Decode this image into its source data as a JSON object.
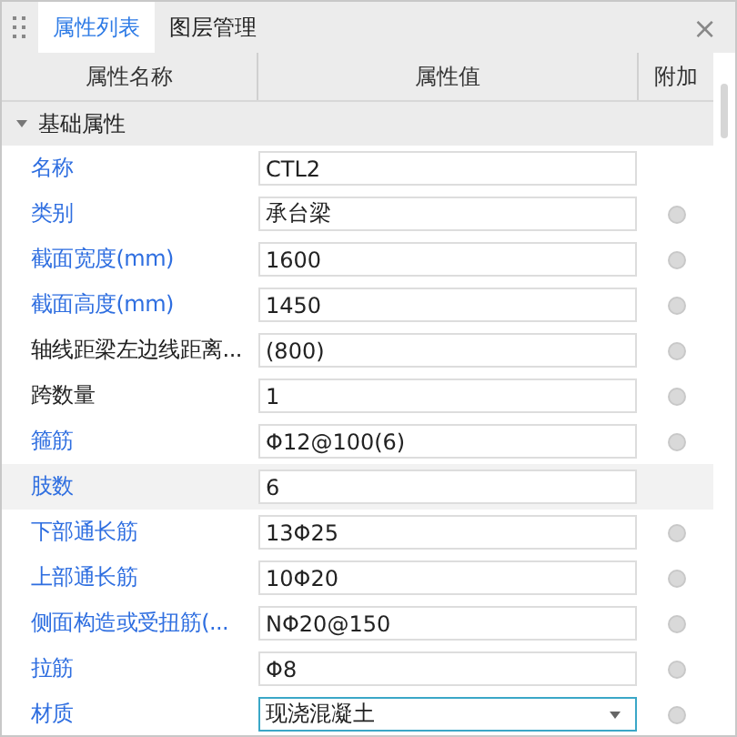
{
  "tabs": [
    {
      "label": "属性列表",
      "selected": true
    },
    {
      "label": "图层管理",
      "selected": false
    }
  ],
  "close": "×",
  "columns": [
    "属性名称",
    "属性值",
    "附加"
  ],
  "group": {
    "label": "基础属性",
    "expanded": true
  },
  "rows": [
    {
      "name": "名称",
      "public": true,
      "value": "CTL2",
      "kind": "text",
      "attach": false,
      "selected": false
    },
    {
      "name": "类别",
      "public": true,
      "value": "承台梁",
      "kind": "text",
      "attach": true,
      "selected": false
    },
    {
      "name": "截面宽度(mm)",
      "public": true,
      "value": "1600",
      "kind": "text",
      "attach": true,
      "selected": false
    },
    {
      "name": "截面高度(mm)",
      "public": true,
      "value": "1450",
      "kind": "text",
      "attach": true,
      "selected": false
    },
    {
      "name": "轴线距梁左边线距离...",
      "public": false,
      "value": "(800)",
      "kind": "text",
      "attach": true,
      "selected": false
    },
    {
      "name": "跨数量",
      "public": false,
      "value": "1",
      "kind": "text",
      "attach": true,
      "selected": false
    },
    {
      "name": "箍筋",
      "public": true,
      "value": "Φ12@100(6)",
      "kind": "text",
      "attach": true,
      "selected": false
    },
    {
      "name": "肢数",
      "public": true,
      "value": "6",
      "kind": "text",
      "attach": false,
      "selected": true
    },
    {
      "name": "下部通长筋",
      "public": true,
      "value": "13Φ25",
      "kind": "text",
      "attach": true,
      "selected": false
    },
    {
      "name": "上部通长筋",
      "public": true,
      "value": "10Φ20",
      "kind": "text",
      "attach": true,
      "selected": false
    },
    {
      "name": "侧面构造或受扭筋(...",
      "public": true,
      "value": "NΦ20@150",
      "kind": "text",
      "attach": true,
      "selected": false
    },
    {
      "name": "拉筋",
      "public": true,
      "value": "Φ8",
      "kind": "text",
      "attach": true,
      "selected": false
    },
    {
      "name": "材质",
      "public": true,
      "value": "现浇混凝土",
      "kind": "dropdown",
      "attach": true,
      "selected": false
    }
  ]
}
